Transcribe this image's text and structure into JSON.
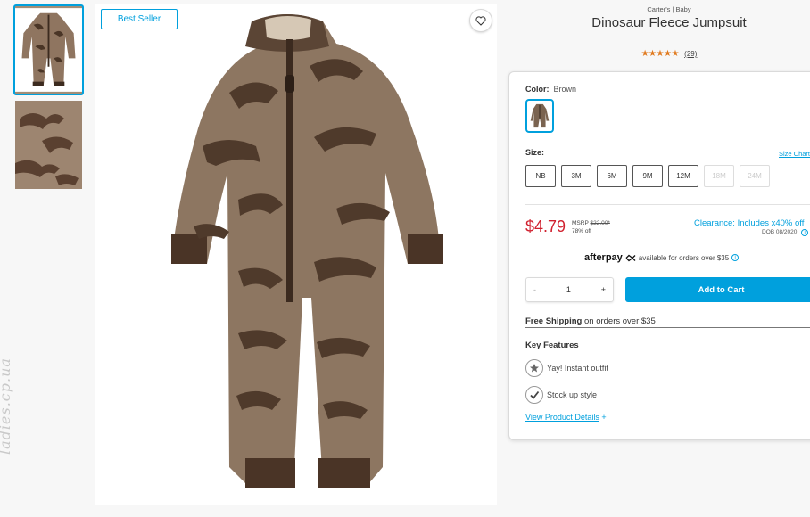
{
  "badge": "Best Seller",
  "watermark": "ladies.cp.ua",
  "product": {
    "brand": "Carter's | Baby",
    "title": "Dinosaur Fleece Jumpsuit",
    "stars": "★★★★★",
    "reviews": "(29)"
  },
  "color": {
    "label": "Color:",
    "value": "Brown"
  },
  "size": {
    "label": "Size:",
    "chart_link": "Size Chart",
    "options": [
      {
        "label": "NB",
        "available": true
      },
      {
        "label": "3M",
        "available": true
      },
      {
        "label": "6M",
        "available": true
      },
      {
        "label": "9M",
        "available": true
      },
      {
        "label": "12M",
        "available": true
      },
      {
        "label": "18M",
        "available": false
      },
      {
        "label": "24M",
        "available": false
      }
    ]
  },
  "pricing": {
    "price": "$4.79",
    "msrp_label": "MSRP",
    "msrp_value": "$22.00*",
    "discount": "78% off",
    "clearance": "Clearance: Includes x40% off",
    "dob": "DOB 08/2020"
  },
  "afterpay": {
    "logo": "afterpay",
    "text": "available for orders over $35"
  },
  "quantity": {
    "minus": "-",
    "value": "1",
    "plus": "+"
  },
  "add_to_cart": "Add to Cart",
  "shipping": {
    "bold": "Free Shipping",
    "rest": "on orders over $35"
  },
  "key_features": {
    "title": "Key Features",
    "items": [
      "Yay! Instant outfit",
      "Stock up style"
    ]
  },
  "view_details": {
    "label": "View Product Details",
    "icon": "+"
  },
  "colors": {
    "accent": "#00a0dd",
    "price": "#d0202e",
    "stars": "#e07a1f"
  }
}
